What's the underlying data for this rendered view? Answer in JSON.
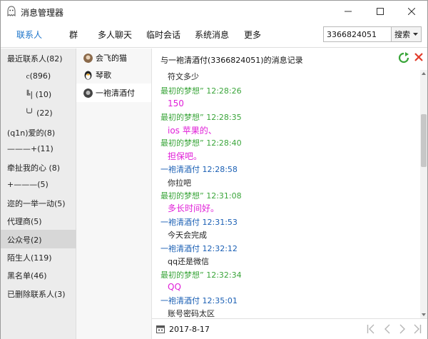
{
  "window": {
    "title": "消息管理器"
  },
  "tabs": [
    {
      "label": "联系人",
      "active": true
    },
    {
      "label": "群"
    },
    {
      "label": "多人聊天"
    },
    {
      "label": "临时会话"
    },
    {
      "label": "系统消息"
    },
    {
      "label": "更多"
    }
  ],
  "search": {
    "value": "3366824051",
    "button_label": "搜索"
  },
  "groups": [
    {
      "label": "最近联系人(82)"
    },
    {
      "label": "ⲥ(896)"
    },
    {
      "label": "╚| (10)"
    },
    {
      "label": "╰╯ (22)"
    },
    {
      "label": "(q1n)爱的(8)"
    },
    {
      "label": "———+(11)"
    },
    {
      "label": "牵扯我的心 (8)"
    },
    {
      "label": "+———(5)"
    },
    {
      "label": "迩的一举一动(5)"
    },
    {
      "label": "代理商(5)"
    },
    {
      "label": "公众号(2)"
    },
    {
      "label": "陌生人(119)"
    },
    {
      "label": "黑名单(46)"
    },
    {
      "label": "已删除联系人(3)"
    }
  ],
  "friends": [
    {
      "name": "会飞的猫"
    },
    {
      "name": "琴歌"
    },
    {
      "name": "一袍清酒付"
    }
  ],
  "chat": {
    "header": "与一袍清酒付(3366824051)的消息记录",
    "messages": [
      {
        "type": "body",
        "style": "black",
        "text": "符文多少"
      },
      {
        "type": "sender",
        "who": "me",
        "text": "最初的梦想” 12:28:26"
      },
      {
        "type": "body",
        "style": "pink",
        "text": "150"
      },
      {
        "type": "sender",
        "who": "me",
        "text": "最初的梦想” 12:28:35"
      },
      {
        "type": "body",
        "style": "pink",
        "text": "ios  苹果的、"
      },
      {
        "type": "sender",
        "who": "me",
        "text": "最初的梦想” 12:28:40"
      },
      {
        "type": "body",
        "style": "pink",
        "text": "担保吧。"
      },
      {
        "type": "sender",
        "who": "other",
        "text": "一袍清酒付 12:28:58"
      },
      {
        "type": "body",
        "style": "black",
        "text": "你拉吧"
      },
      {
        "type": "sender",
        "who": "me",
        "text": "最初的梦想” 12:31:08"
      },
      {
        "type": "body",
        "style": "pink",
        "text": "多长时间好。"
      },
      {
        "type": "sender",
        "who": "other",
        "text": "一袍清酒付 12:31:53"
      },
      {
        "type": "body",
        "style": "black",
        "text": "今天会完成"
      },
      {
        "type": "sender",
        "who": "other",
        "text": "一袍清酒付 12:32:12"
      },
      {
        "type": "body",
        "style": "black",
        "text": "qq还是微信"
      },
      {
        "type": "sender",
        "who": "me",
        "text": "最初的梦想” 12:32:34"
      },
      {
        "type": "body",
        "style": "pink",
        "text": "QQ"
      },
      {
        "type": "sender",
        "who": "other",
        "text": "一袍清酒付 12:35:01"
      },
      {
        "type": "body",
        "style": "black",
        "text": "账号密码太区"
      }
    ],
    "date": "2017-8-17"
  },
  "icons": {
    "app": "ghost-icon",
    "refresh": "refresh-icon",
    "delete": "delete-icon",
    "calendar": "calendar-icon"
  },
  "colors": {
    "accent_blue": "#1a73c9",
    "sender_me_green": "#3aa53a",
    "sender_other_blue": "#1a5fb4",
    "message_pink": "#e020d8",
    "selected_bg": "#d7d7d7"
  }
}
